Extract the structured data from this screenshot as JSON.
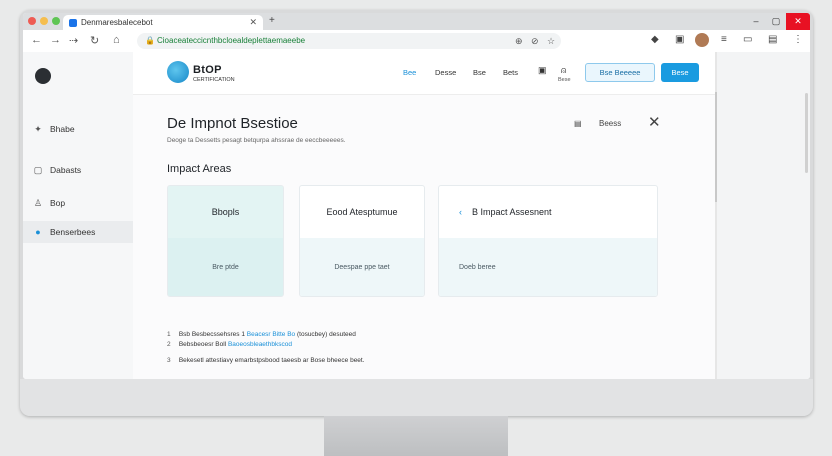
{
  "browser": {
    "tab_title": "Denmaresbalecebot",
    "url": "Cioaceateccicnthbcloealdeplettaemaeebe",
    "new_tab_symbol": "+",
    "window_controls": [
      "–",
      "▢",
      "✕"
    ]
  },
  "sidebar": {
    "items": [
      {
        "label": "Bhabe",
        "icon": "puzzle-icon"
      },
      {
        "label": "Dabasts",
        "icon": "document-icon"
      },
      {
        "label": "Bop",
        "icon": "user-icon"
      },
      {
        "label": "Benserbees",
        "icon": "circle-icon"
      }
    ],
    "active_index": 3
  },
  "header": {
    "brand": "BtOP",
    "brand_sub": "CERTIFICATION",
    "nav": [
      "Bee",
      "Desse",
      "Bse",
      "Bets"
    ],
    "icon_label": "Bese",
    "outline_button": "Bse Beeeee",
    "primary_button": "Bese"
  },
  "page": {
    "title": "De  Impnot Bsestioe",
    "subtitle": "Deoge ta Dessetts pesagt betqurpa ahssrae de eeccbeeeees.",
    "tool_label": "Beess",
    "section_title": "Impact Areas",
    "cards": [
      {
        "title": "Bbopls",
        "subtitle": "Bre ptde"
      },
      {
        "title": "Eood Atesptumue",
        "subtitle": "Deespae ppe taet"
      },
      {
        "title": "B Impact Assesnent",
        "subtitle": "Doeb beree"
      }
    ],
    "list": [
      {
        "num": "1",
        "text": "Bsb Besbecssehsres 1",
        "link": "Beacesr Bitte Bo",
        "tail": "(tosucbey) desuteed"
      },
      {
        "num": "2",
        "text": "Bebsbeoesr Boll",
        "link": "Baoeosbleaethbkscod",
        "tail": ""
      },
      {
        "num": "3",
        "text": "Bekesetl attestiavy emarbstpsbood taeesb ar Bose bheece beet.",
        "link": "",
        "tail": ""
      }
    ]
  },
  "colors": {
    "accent": "#1a9be0",
    "card_tint": "#e3f4f3",
    "close_red": "#e81123"
  }
}
